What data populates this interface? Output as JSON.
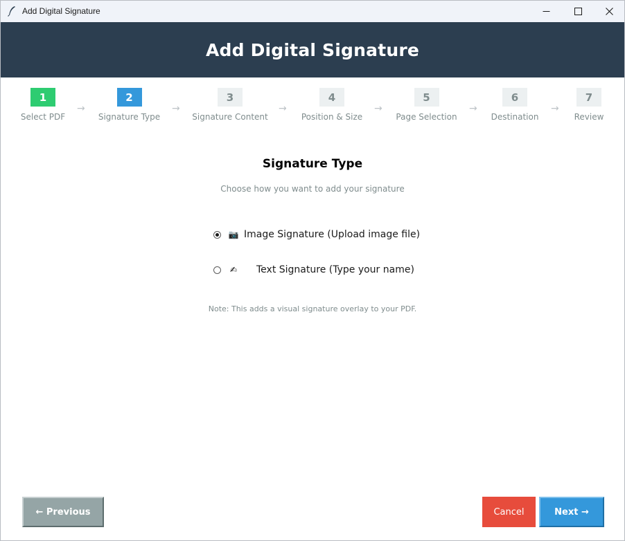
{
  "window": {
    "title": "Add Digital Signature",
    "icon": "feather-icon"
  },
  "header": {
    "title": "Add Digital Signature"
  },
  "colors": {
    "header_bg": "#2c3e50",
    "step_done": "#2ecc71",
    "step_active": "#3498db",
    "step_pending": "#ecf0f1",
    "cancel": "#e74c3c",
    "next": "#3498db",
    "previous": "#95a5a6"
  },
  "steps": [
    {
      "number": "1",
      "label": "Select PDF",
      "state": "done"
    },
    {
      "number": "2",
      "label": "Signature Type",
      "state": "active"
    },
    {
      "number": "3",
      "label": "Signature Content",
      "state": "pending"
    },
    {
      "number": "4",
      "label": "Position & Size",
      "state": "pending"
    },
    {
      "number": "5",
      "label": "Page Selection",
      "state": "pending"
    },
    {
      "number": "6",
      "label": "Destination",
      "state": "pending"
    },
    {
      "number": "7",
      "label": "Review",
      "state": "pending"
    }
  ],
  "step_arrow": "→",
  "content": {
    "title": "Signature Type",
    "subtitle": "Choose how you want to add your signature",
    "options": [
      {
        "icon": "📷",
        "icon_name": "camera-icon",
        "label": "Image Signature (Upload image file)",
        "selected": true
      },
      {
        "icon": "✍",
        "icon_name": "writing-hand-icon",
        "label": "Text Signature (Type your name)",
        "selected": false
      }
    ],
    "note": "Note: This adds a visual signature overlay to your PDF."
  },
  "footer": {
    "previous_label": "← Previous",
    "cancel_label": "Cancel",
    "next_label": "Next →"
  }
}
